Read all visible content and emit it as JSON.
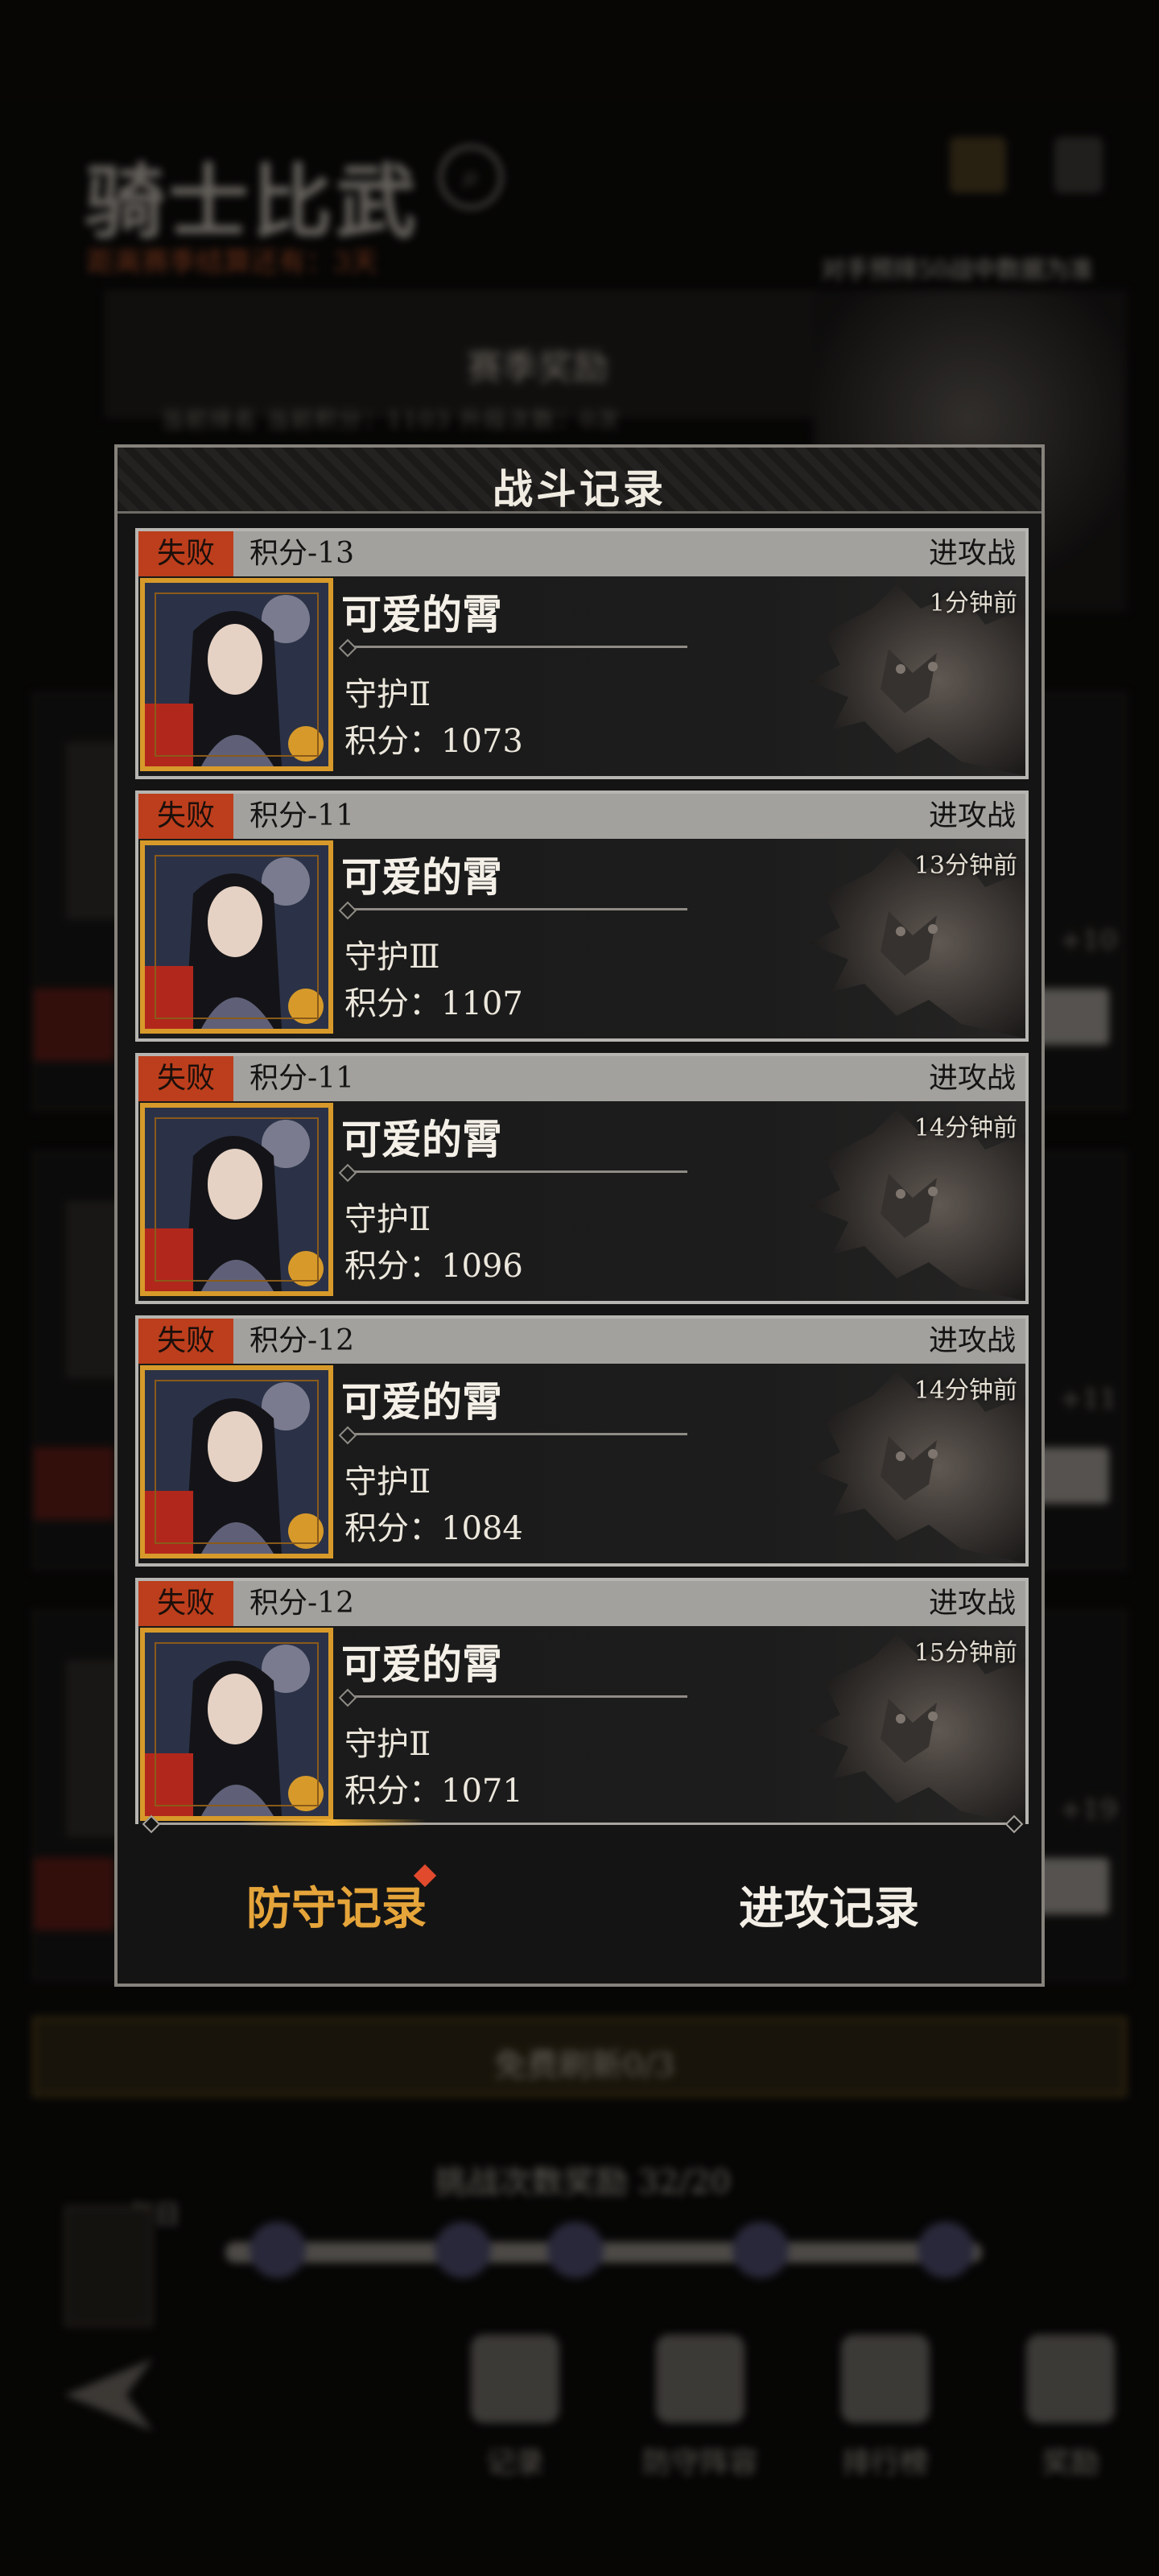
{
  "background": {
    "title": "骑士比武",
    "subtitle": "距离赛季结算还有：3天",
    "tip": "对手预排50战中数据为准",
    "season_label": "赛季奖励",
    "season_row": "当前排名    当前积分：1103    升段次数：0次",
    "refresh_label": "免费刷新0/3",
    "reward_title": "挑战次数奖励 32/20",
    "daily_label": "每日",
    "nav": [
      "记录",
      "防守阵容",
      "排行榜",
      "奖励"
    ]
  },
  "dialog": {
    "title": "战斗记录",
    "records": [
      {
        "result": "失败",
        "score_delta": "积分-13",
        "battle_type": "进攻战",
        "time_ago": "1分钟前",
        "player_name": "可爱的霄",
        "rank": "守护Ⅱ",
        "points": "积分：1073"
      },
      {
        "result": "失败",
        "score_delta": "积分-11",
        "battle_type": "进攻战",
        "time_ago": "13分钟前",
        "player_name": "可爱的霄",
        "rank": "守护Ⅲ",
        "points": "积分：1107"
      },
      {
        "result": "失败",
        "score_delta": "积分-11",
        "battle_type": "进攻战",
        "time_ago": "14分钟前",
        "player_name": "可爱的霄",
        "rank": "守护Ⅱ",
        "points": "积分：1096"
      },
      {
        "result": "失败",
        "score_delta": "积分-12",
        "battle_type": "进攻战",
        "time_ago": "14分钟前",
        "player_name": "可爱的霄",
        "rank": "守护Ⅱ",
        "points": "积分：1084"
      },
      {
        "result": "失败",
        "score_delta": "积分-12",
        "battle_type": "进攻战",
        "time_ago": "15分钟前",
        "player_name": "可爱的霄",
        "rank": "守护Ⅱ",
        "points": "积分：1071"
      }
    ],
    "tabs": {
      "defense": "防守记录",
      "attack": "进攻记录",
      "active": "defense"
    }
  },
  "colors": {
    "accent_gold": "#e6a53a",
    "defeat_red": "#bc3e1c",
    "notification_dot": "#e24a2e"
  }
}
